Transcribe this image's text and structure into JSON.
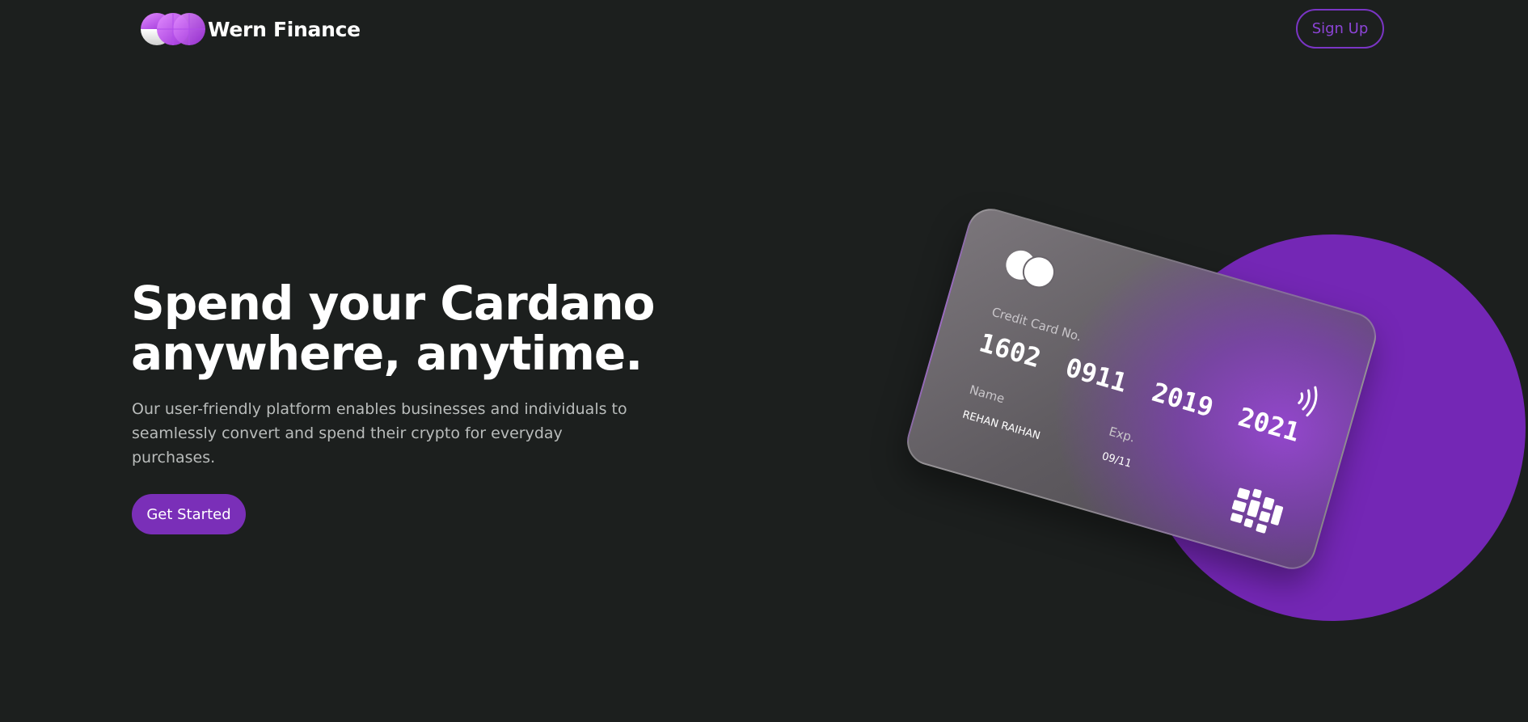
{
  "header": {
    "brand_name": "Wern Finance",
    "signup_label": "Sign Up"
  },
  "hero": {
    "headline_line1": "Spend your Cardano",
    "headline_line2": "anywhere, anytime.",
    "description": "Our user-friendly platform enables businesses and individuals to seamlessly convert and spend their crypto for everyday purchases.",
    "cta_label": "Get Started"
  },
  "card": {
    "number_label": "Credit Card No.",
    "number_groups": [
      "1602",
      "0911",
      "2019",
      "2021"
    ],
    "name_label": "Name",
    "name_value": "REHAN RAIHAN",
    "exp_label": "Exp.",
    "exp_value": "09/11"
  },
  "colors": {
    "background": "#1c1f1e",
    "accent": "#7a2fb8",
    "circle": "#7427b5",
    "text_primary": "#ffffff",
    "text_secondary": "#b9bcbb"
  },
  "icons": {
    "logo": "half-circles-logo-icon",
    "card_logo": "overlapping-circles-icon",
    "contactless": "contactless-icon",
    "chip": "chip-icon"
  }
}
